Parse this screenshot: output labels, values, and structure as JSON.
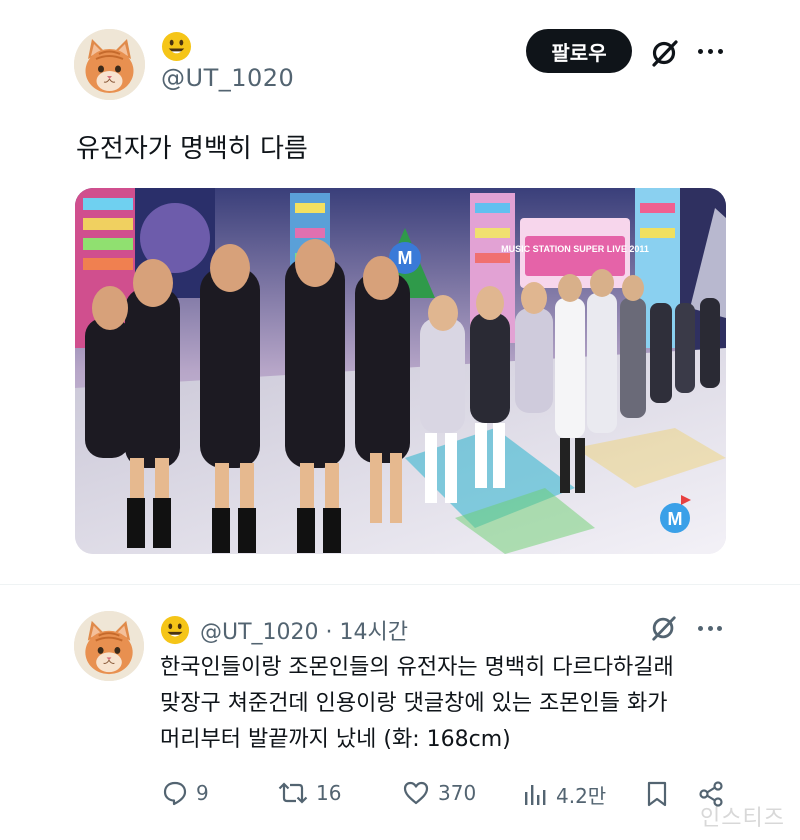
{
  "tweet": {
    "display_emoji": "smiling-face-emoji",
    "handle": "@UT_1020",
    "follow_label": "팔로우",
    "text": "유전자가 명백히 다름",
    "media": {
      "banner_text": "MUSIC STATION SUPER LIVE 2011",
      "logo_letter": "M"
    }
  },
  "reply": {
    "display_emoji": "smiling-face-emoji",
    "handle": "@UT_1020",
    "separator": "·",
    "time": "14시간",
    "lines": [
      "한국인들이랑 조몬인들의 유전자는 명백히 다르다하길래",
      "맞장구 쳐준건데 인용이랑 댓글창에 있는 조몬인들 화가",
      "머리부터 발끝까지 났네 (화: 168cm)"
    ],
    "actions": {
      "replies": "9",
      "reposts": "16",
      "likes": "370",
      "views": "4.2만"
    }
  },
  "watermark": "인스티즈",
  "colors": {
    "text": "#0f1419",
    "secondary": "#536471",
    "emoji": "#f5c518"
  }
}
